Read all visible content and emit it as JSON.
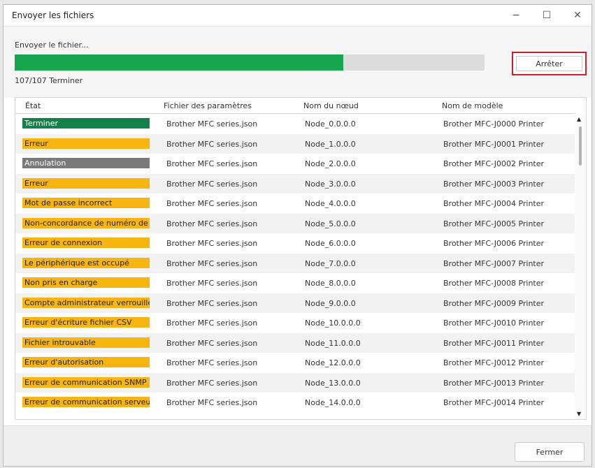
{
  "window": {
    "title": "Envoyer les fichiers"
  },
  "controls": {
    "minimize": "−",
    "maximize": "☐",
    "close": "✕"
  },
  "upload": {
    "label": "Envoyer le fichier...",
    "progress_fraction": 0.7,
    "stop_label": "Arrêter",
    "count": "107/107 Terminer"
  },
  "table": {
    "headers": [
      "État",
      "Fichier des paramètres",
      "Nom du nœud",
      "Nom de modèle"
    ],
    "rows": [
      {
        "status": "Terminer",
        "kind": "green",
        "file": "Brother MFC series.json",
        "node": "Node_0.0.0.0",
        "model": "Brother MFC-J0000 Printer"
      },
      {
        "status": "Erreur",
        "kind": "yellow",
        "file": "Brother MFC series.json",
        "node": "Node_1.0.0.0",
        "model": "Brother MFC-J0001 Printer"
      },
      {
        "status": "Annulation",
        "kind": "gray",
        "file": "Brother MFC series.json",
        "node": "Node_2.0.0.0",
        "model": "Brother MFC-J0002 Printer"
      },
      {
        "status": "Erreur",
        "kind": "yellow",
        "file": "Brother MFC series.json",
        "node": "Node_3.0.0.0",
        "model": "Brother MFC-J0003 Printer"
      },
      {
        "status": "Mot de passe incorrect",
        "kind": "yellow",
        "file": "Brother MFC series.json",
        "node": "Node_4.0.0.0",
        "model": "Brother MFC-J0004 Printer"
      },
      {
        "status": "Non-concordance de numéro de",
        "kind": "yellow",
        "file": "Brother MFC series.json",
        "node": "Node_5.0.0.0",
        "model": "Brother MFC-J0005 Printer"
      },
      {
        "status": "Erreur de connexion",
        "kind": "yellow",
        "file": "Brother MFC series.json",
        "node": "Node_6.0.0.0",
        "model": "Brother MFC-J0006 Printer"
      },
      {
        "status": "Le périphérique est occupé",
        "kind": "yellow",
        "file": "Brother MFC series.json",
        "node": "Node_7.0.0.0",
        "model": "Brother MFC-J0007 Printer"
      },
      {
        "status": "Non pris en charge",
        "kind": "yellow",
        "file": "Brother MFC series.json",
        "node": "Node_8.0.0.0",
        "model": "Brother MFC-J0008 Printer"
      },
      {
        "status": "Compte administrateur verrouillé",
        "kind": "yellow",
        "file": "Brother MFC series.json",
        "node": "Node_9.0.0.0",
        "model": "Brother MFC-J0009 Printer"
      },
      {
        "status": "Erreur d'écriture fichier CSV",
        "kind": "yellow",
        "file": "Brother MFC series.json",
        "node": "Node_10.0.0.0",
        "model": "Brother MFC-J0010 Printer"
      },
      {
        "status": "Fichier introuvable",
        "kind": "yellow",
        "file": "Brother MFC series.json",
        "node": "Node_11.0.0.0",
        "model": "Brother MFC-J0011 Printer"
      },
      {
        "status": "Erreur d'autorisation",
        "kind": "yellow",
        "file": "Brother MFC series.json",
        "node": "Node_12.0.0.0",
        "model": "Brother MFC-J0012 Printer"
      },
      {
        "status": "Erreur de communication SNMP",
        "kind": "yellow",
        "file": "Brother MFC series.json",
        "node": "Node_13.0.0.0",
        "model": "Brother MFC-J0013 Printer"
      },
      {
        "status": "Erreur de communication serveur",
        "kind": "yellow",
        "file": "Brother MFC series.json",
        "node": "Node_14.0.0.0",
        "model": "Brother MFC-J0014 Printer"
      }
    ]
  },
  "scroll": {
    "up": "▲",
    "down": "▼"
  },
  "footer": {
    "close_label": "Fermer"
  },
  "colors": {
    "progress": "#17a650",
    "success": "#14804a",
    "cancel": "#7a7a7a",
    "error": "#f8b50f",
    "highlight": "#d0202c"
  }
}
